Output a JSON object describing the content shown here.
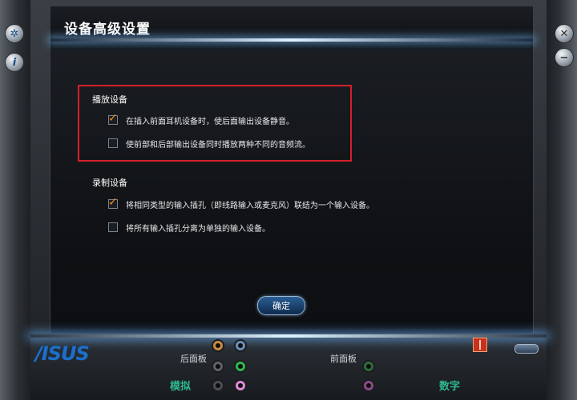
{
  "window": {
    "title": "设备高级设置"
  },
  "playback": {
    "heading": "播放设备",
    "options": [
      {
        "label": "在插入前面耳机设备时，使后面输出设备静音。",
        "checked": true
      },
      {
        "label": "使前部和后部输出设备同时播放两种不同的音频流。",
        "checked": false
      }
    ]
  },
  "recording": {
    "heading": "录制设备",
    "options": [
      {
        "label": "将相同类型的输入插孔（即线路输入或麦克风）联结为一个输入设备。",
        "checked": true
      },
      {
        "label": "将所有输入插孔分离为单独的输入设备。",
        "checked": false
      }
    ]
  },
  "ok_button": {
    "label": "确定"
  },
  "bottom_bar": {
    "brand": "/ISUS",
    "rear_panel_label": "后面板",
    "front_panel_label": "前面板",
    "analog_label": "模拟",
    "digital_label": "数字"
  },
  "colors": {
    "accent": "#1d6fc9",
    "highlight_box": "#d5202a",
    "checkmark": "#f08a1c",
    "green_text": "#2fb88c"
  },
  "icons": {
    "left_buttons": [
      "settings-icon",
      "info-icon"
    ],
    "right_buttons": [
      "close-icon",
      "minimize-icon"
    ]
  }
}
